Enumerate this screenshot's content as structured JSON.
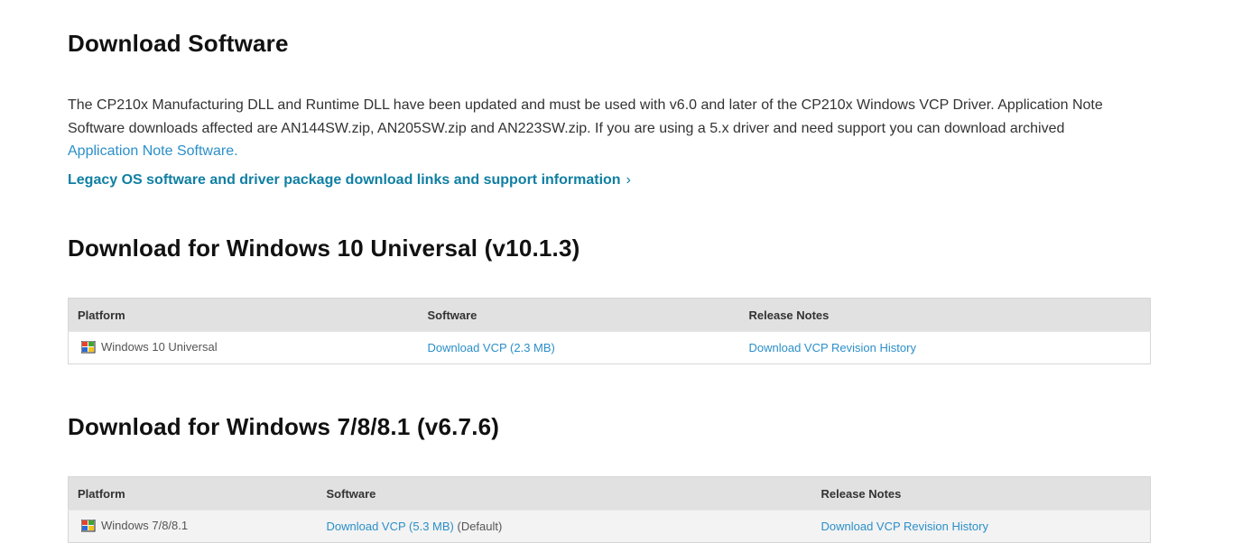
{
  "heading": "Download Software",
  "intro": {
    "text": "The CP210x Manufacturing DLL and Runtime DLL have been updated and must be used with v6.0 and later of the CP210x Windows VCP Driver. Application Note Software downloads affected are AN144SW.zip, AN205SW.zip and AN223SW.zip. If you are using a 5.x driver and need support you can download archived ",
    "link": "Application Note Software."
  },
  "legacy_link": {
    "label": "Legacy OS software and driver package download links and support information",
    "chevron": "›"
  },
  "sections": [
    {
      "title": "Download for Windows 10 Universal (v10.1.3)",
      "columns": [
        "Platform",
        "Software",
        "Release Notes"
      ],
      "rows": [
        {
          "platform": "Windows 10 Universal",
          "software_link": "Download VCP (2.3 MB)",
          "software_suffix": "",
          "notes_link": "Download VCP Revision History"
        }
      ]
    },
    {
      "title": "Download for Windows 7/8/8.1 (v6.7.6)",
      "columns": [
        "Platform",
        "Software",
        "Release Notes"
      ],
      "rows": [
        {
          "platform": "Windows 7/8/8.1",
          "software_link": "Download VCP (5.3 MB)",
          "software_suffix": " (Default)",
          "notes_link": "Download VCP Revision History"
        }
      ]
    }
  ],
  "icons": {
    "platform": "windows-logo-icon"
  },
  "colors": {
    "link": "#2b8fc9",
    "legacy_link": "#0f7fa3",
    "header_bg": "#e1e1e1"
  }
}
